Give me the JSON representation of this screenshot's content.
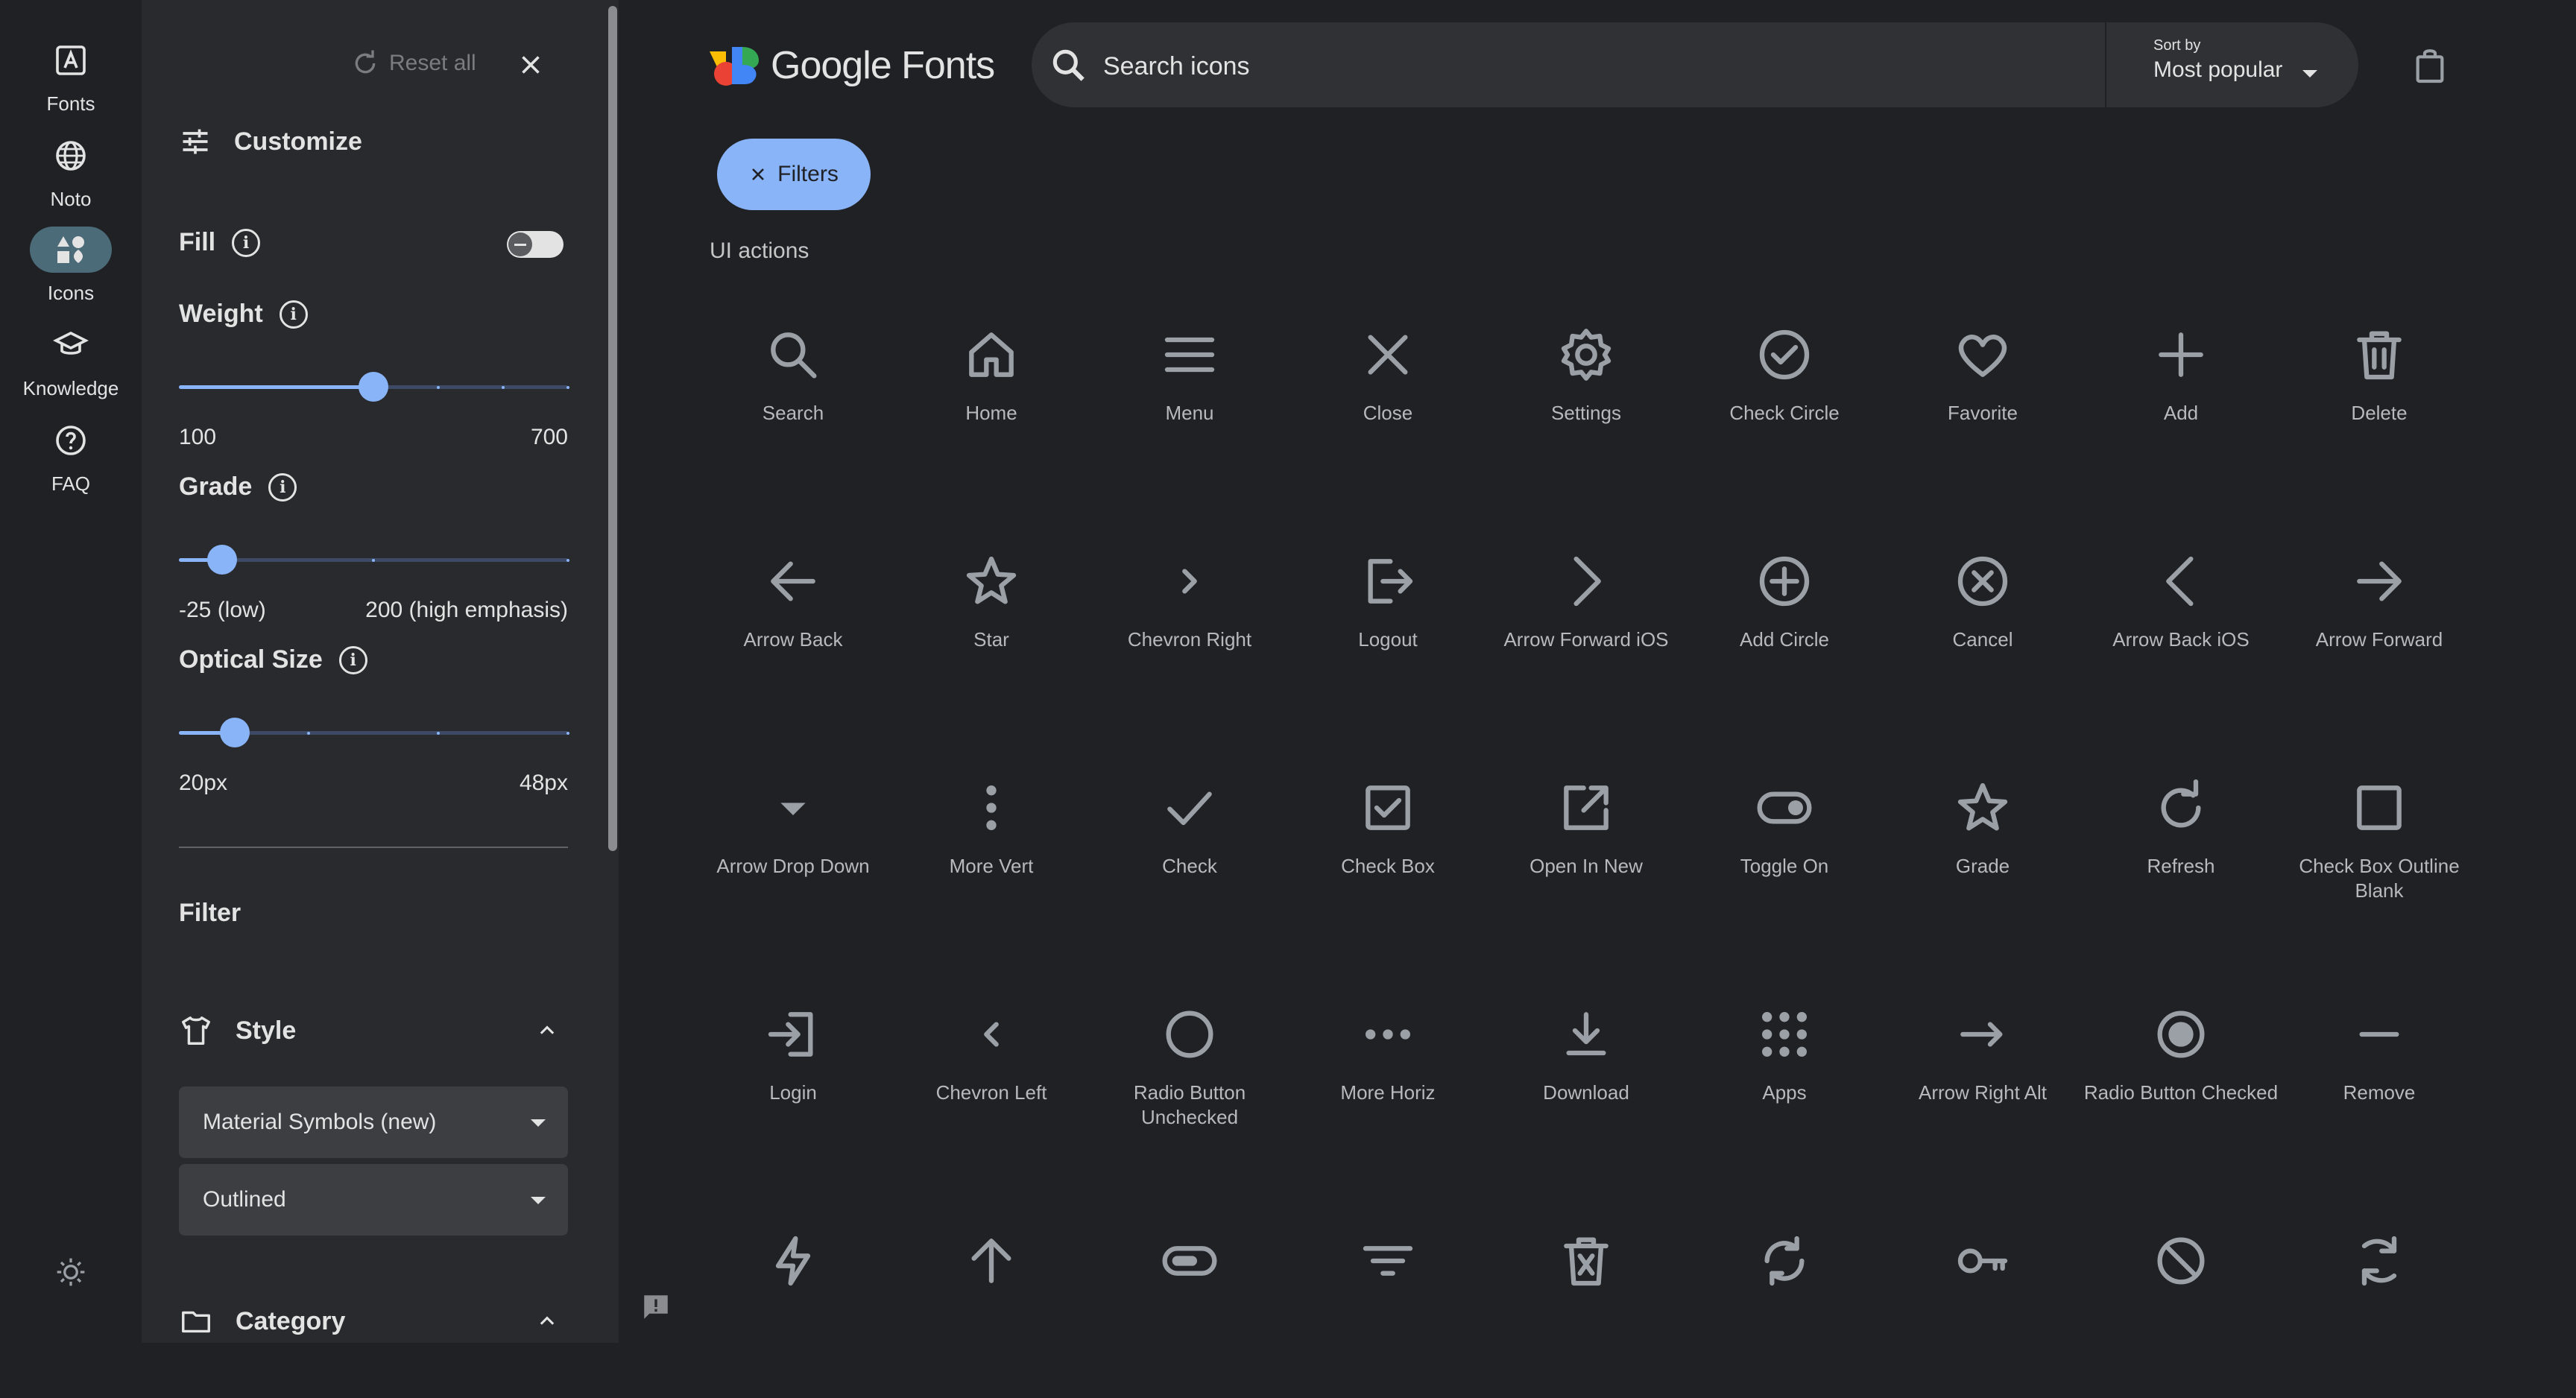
{
  "rail": {
    "items": [
      {
        "label": "Fonts",
        "icon": "font-a-icon"
      },
      {
        "label": "Noto",
        "icon": "globe-icon"
      },
      {
        "label": "Icons",
        "icon": "shapes-icon"
      },
      {
        "label": "Knowledge",
        "icon": "school-icon"
      },
      {
        "label": "FAQ",
        "icon": "help-icon"
      }
    ],
    "active": "Icons",
    "theme_icon": "brightness-icon"
  },
  "panel": {
    "reset_label": "Reset all",
    "customize_title": "Customize",
    "fill": {
      "label": "Fill",
      "on": false
    },
    "weight": {
      "label": "Weight",
      "min_label": "100",
      "max_label": "700",
      "value": 400,
      "min": 100,
      "max": 700
    },
    "grade": {
      "label": "Grade",
      "min_label": "-25 (low)",
      "max_label": "200 (high emphasis)",
      "value": 0,
      "min": -25,
      "max": 200
    },
    "optical_size": {
      "label": "Optical Size",
      "min_label": "20px",
      "max_label": "48px",
      "value": 24,
      "min": 20,
      "max": 48
    },
    "filter_title": "Filter",
    "style": {
      "title": "Style",
      "family_value": "Material Symbols (new)",
      "variant_value": "Outlined"
    },
    "category": {
      "title": "Category"
    }
  },
  "header": {
    "logo_text": "Google Fonts",
    "search_placeholder": "Search icons",
    "sort_caption": "Sort by",
    "sort_value": "Most popular"
  },
  "filters_button": "Filters",
  "category_title": "UI actions",
  "icons": [
    "Search",
    "Home",
    "Menu",
    "Close",
    "Settings",
    "Check Circle",
    "Favorite",
    "Add",
    "Delete",
    "Arrow Back",
    "Star",
    "Chevron Right",
    "Logout",
    "Arrow Forward iOS",
    "Add Circle",
    "Cancel",
    "Arrow Back iOS",
    "Arrow Forward",
    "Arrow Drop Down",
    "More Vert",
    "Check",
    "Check Box",
    "Open In New",
    "Toggle On",
    "Grade",
    "Refresh",
    "Check Box Outline Blank",
    "Login",
    "Chevron Left",
    "Radio Button Unchecked",
    "More Horiz",
    "Download",
    "Apps",
    "Arrow Right Alt",
    "Radio Button Checked",
    "Remove",
    "",
    "",
    "",
    "",
    "",
    "",
    "",
    "",
    ""
  ],
  "colors": {
    "accent": "#8ab4f8",
    "background": "#1f2125",
    "panel": "#292a2d",
    "icon": "#9aa0a6"
  }
}
